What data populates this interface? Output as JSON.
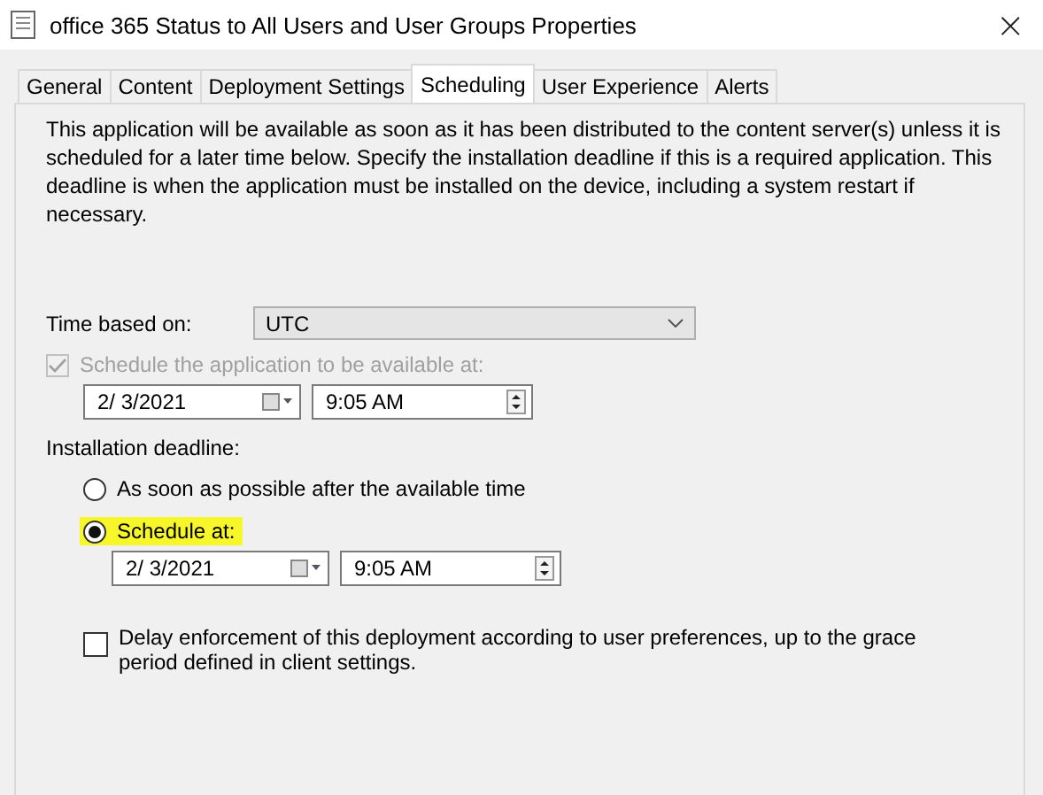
{
  "window": {
    "title": "office 365 Status to All Users and User Groups Properties",
    "close": "×"
  },
  "tabs": [
    {
      "label": "General",
      "selected": false
    },
    {
      "label": "Content",
      "selected": false
    },
    {
      "label": "Deployment Settings",
      "selected": false
    },
    {
      "label": "Scheduling",
      "selected": true
    },
    {
      "label": "User Experience",
      "selected": false
    },
    {
      "label": "Alerts",
      "selected": false
    }
  ],
  "description": "This application will be available as soon as it has been distributed to the content server(s) unless it is scheduled for a later time below. Specify the installation deadline if this is a required application. This deadline is when the application must be installed on the device, including a system restart if necessary.",
  "time_based_on": {
    "label": "Time based on:",
    "value": "UTC"
  },
  "available": {
    "label": "Schedule the application to be available at:",
    "checked": true,
    "disabled": true,
    "date": "2/  3/2021",
    "time": "9:05 AM"
  },
  "deadline": {
    "label": "Installation deadline:",
    "options": [
      {
        "label": "As soon as possible after the available time",
        "selected": false,
        "highlighted": false
      },
      {
        "label": "Schedule at:",
        "selected": true,
        "highlighted": true
      }
    ],
    "date": "2/  3/2021",
    "time": "9:05 AM"
  },
  "delay": {
    "label": "Delay enforcement of this deployment according to user preferences, up to the grace period defined in client settings.",
    "checked": false
  }
}
